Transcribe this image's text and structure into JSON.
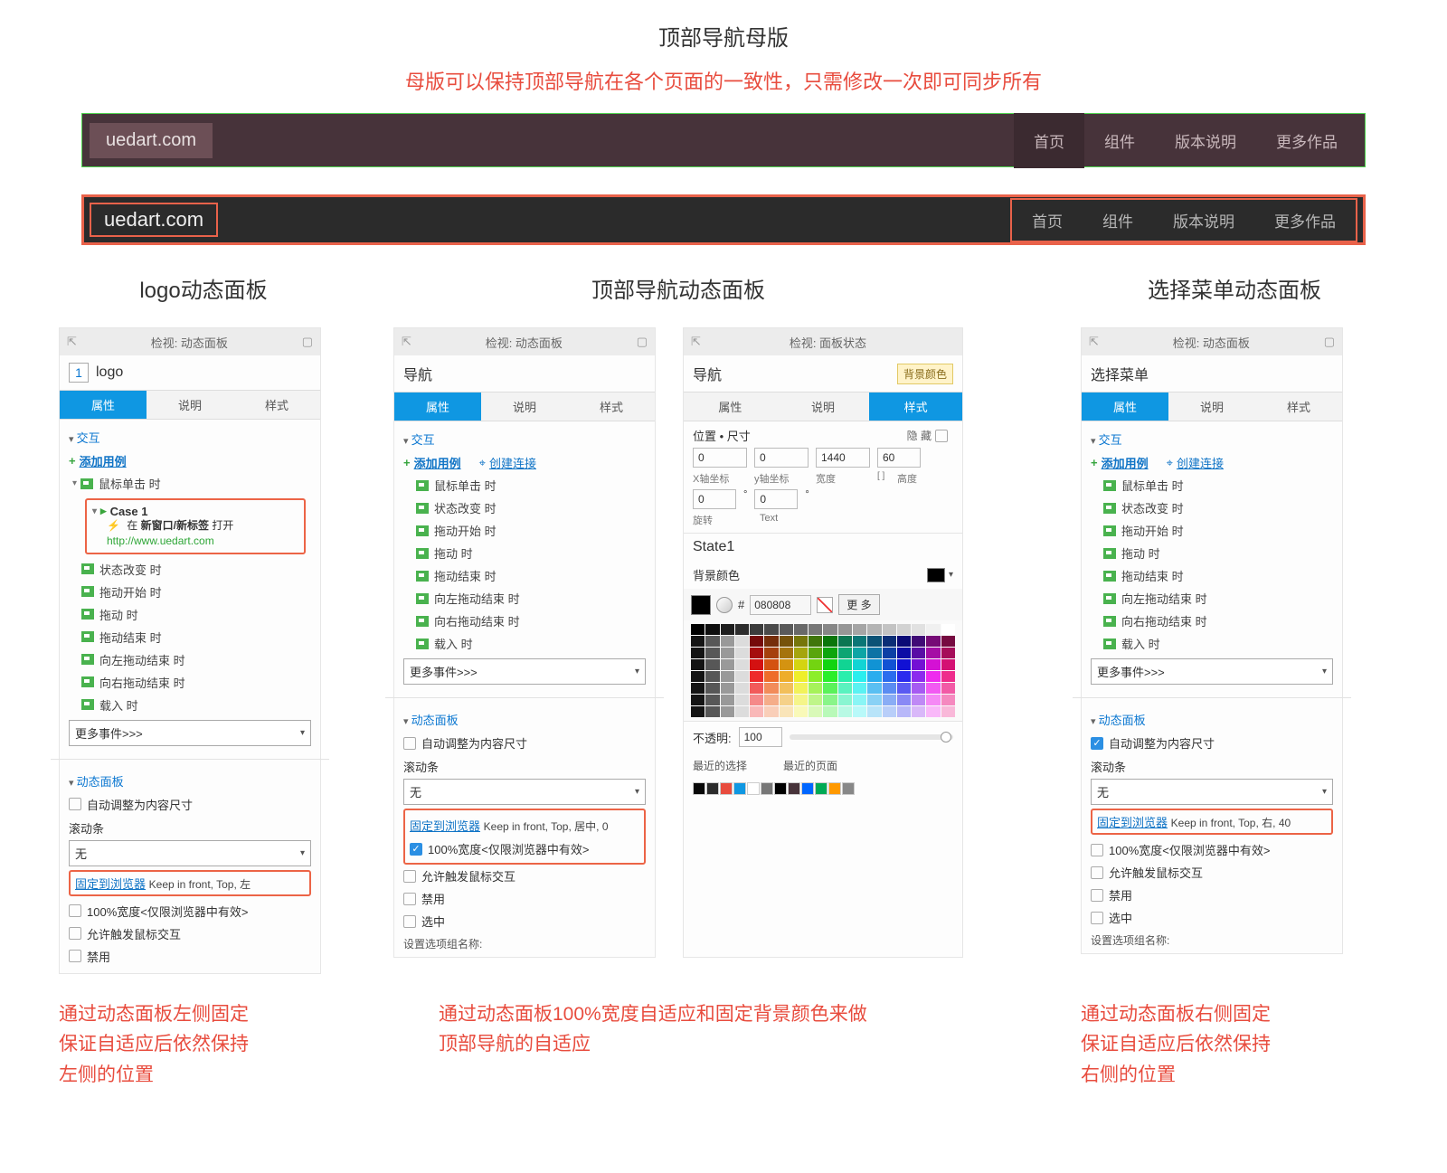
{
  "header": {
    "title_main": "顶部导航母版",
    "subtitle_red": "母版可以保持顶部导航在各个页面的一致性，只需修改一次即可同步所有"
  },
  "navbar": {
    "logo": "uedart.com",
    "links": [
      "首页",
      "组件",
      "版本说明",
      "更多作品"
    ]
  },
  "sections": {
    "logo_title": "logo动态面板",
    "nav_title": "顶部导航动态面板",
    "menu_title": "选择菜单动态面板"
  },
  "panel_common": {
    "inspect_dp": "检视: 动态面板",
    "inspect_state": "检视: 面板状态",
    "tab_attr": "属性",
    "tab_desc": "说明",
    "tab_style": "样式",
    "interact": "交互",
    "add_case": "添加用例",
    "create_link": "创建连接",
    "more_events": "更多事件>>>",
    "dp_section": "动态面板",
    "auto_size": "自动调整为内容尺寸",
    "scrollbar": "滚动条",
    "scrollbar_value": "无",
    "pin_browser": "固定到浏览器",
    "full_width": "100%宽度<仅限浏览器中有效>",
    "allow_mouse": "允许触发鼠标交互",
    "disable": "禁用",
    "selected": "选中",
    "group_name": "设置选项组名称:"
  },
  "logo_panel": {
    "num": "1",
    "name": "logo",
    "events": {
      "mouse_click": "鼠标单击 时",
      "case1": "Case 1",
      "action_prefix": "在",
      "action_bold": "新窗口/新标签",
      "action_open": "打开",
      "url": "http://www.uedart.com",
      "state_change": "状态改变 时",
      "drag_start": "拖动开始 时",
      "drag": "拖动 时",
      "drag_end": "拖动结束 时",
      "drag_left_end": "向左拖动结束 时",
      "drag_right_end": "向右拖动结束 时",
      "load": "载入 时"
    },
    "pin_text": "Keep in front, Top, 左"
  },
  "nav_panel": {
    "name": "导航",
    "events": {
      "mouse_click": "鼠标单击 时",
      "state_change": "状态改变 时",
      "drag_start": "拖动开始 时",
      "drag": "拖动 时",
      "drag_end": "拖动结束 时",
      "drag_left_end": "向左拖动结束 时",
      "drag_right_end": "向右拖动结束 时",
      "load": "载入 时"
    },
    "pin_text": "Keep in front, Top, 居中, 0"
  },
  "style_panel": {
    "name": "导航",
    "bg_badge": "背景颜色",
    "pos_size": "位置 • 尺寸",
    "hide": "隐 藏",
    "x": "0",
    "y": "0",
    "w": "1440",
    "h": "60",
    "xlabel": "X轴坐标",
    "ylabel": "y轴坐标",
    "wlabel": "宽度",
    "wbr": "[ ]",
    "hlabel": "高度",
    "rot": "0",
    "rotlabel": "旋转",
    "txt": "0",
    "txtlabel": "Text",
    "state1": "State1",
    "bg_label": "背景颜色",
    "hex": "080808",
    "more": "更 多",
    "opacity_label": "不透明:",
    "opacity_value": "100",
    "recent_sel": "最近的选择",
    "recent_page": "最近的页面"
  },
  "menu_panel": {
    "name": "选择菜单",
    "events": {
      "mouse_click": "鼠标单击 时",
      "state_change": "状态改变 时",
      "drag_start": "拖动开始 时",
      "drag": "拖动 时",
      "drag_end": "拖动结束 时",
      "drag_left_end": "向左拖动结束 时",
      "drag_right_end": "向右拖动结束 时",
      "load": "载入 时"
    },
    "pin_text": "Keep in front, Top, 右, 40"
  },
  "bottom": {
    "col1_l1": "通过动态面板左侧固定",
    "col1_l2": "保证自适应后依然保持",
    "col1_l3": "左侧的位置",
    "col2_l1": "通过动态面板100%宽度自适应和固定背景颜色来做",
    "col2_l2": "顶部导航的自适应",
    "col3_l1": "通过动态面板右侧固定",
    "col3_l2": "保证自适应后依然保持",
    "col3_l3": "右侧的位置"
  }
}
